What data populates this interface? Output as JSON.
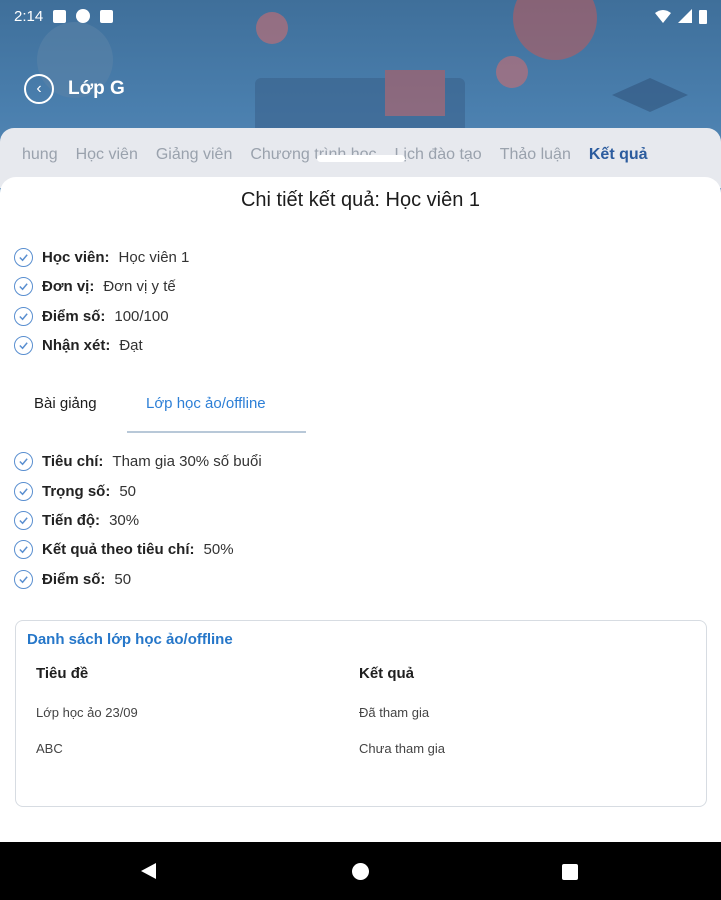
{
  "status_bar": {
    "time": "2:14"
  },
  "header": {
    "title": "Lớp G"
  },
  "tabs": [
    {
      "label": "hung"
    },
    {
      "label": "Học viên"
    },
    {
      "label": "Giảng viên"
    },
    {
      "label": "Chương trình học"
    },
    {
      "label": "Lịch đào tạo"
    },
    {
      "label": "Thảo luận"
    },
    {
      "label": "Kết quả"
    }
  ],
  "sheet": {
    "title": "Chi tiết kết quả: Học viên 1",
    "student_info": [
      {
        "label": "Học viên:",
        "value": "Học viên 1"
      },
      {
        "label": "Đơn vị:",
        "value": "Đơn vị y tế"
      },
      {
        "label": "Điểm số:",
        "value": "100/100"
      },
      {
        "label": "Nhận xét:",
        "value": "Đạt"
      }
    ],
    "sub_tabs": [
      {
        "label": "Bài giảng"
      },
      {
        "label": "Lớp học ảo/offline"
      }
    ],
    "criteria": [
      {
        "label": "Tiêu chí:",
        "value": "Tham gia 30% số buổi"
      },
      {
        "label": "Trọng số:",
        "value": "50"
      },
      {
        "label": "Tiến độ:",
        "value": "30%"
      },
      {
        "label": "Kết quả theo tiêu chí:",
        "value": "50%"
      },
      {
        "label": "Điểm số:",
        "value": "50"
      }
    ],
    "class_list": {
      "title": "Danh sách lớp học ảo/offline",
      "columns": [
        "Tiêu đề",
        "Kết quả"
      ],
      "rows": [
        [
          "Lớp học ảo 23/09",
          "Đã tham gia"
        ],
        [
          "ABC",
          "Chưa tham gia"
        ]
      ]
    }
  },
  "colors": {
    "accent": "#2d7fd6",
    "header_bg": "#4a7fae",
    "active_tab": "#2c5c9e"
  }
}
